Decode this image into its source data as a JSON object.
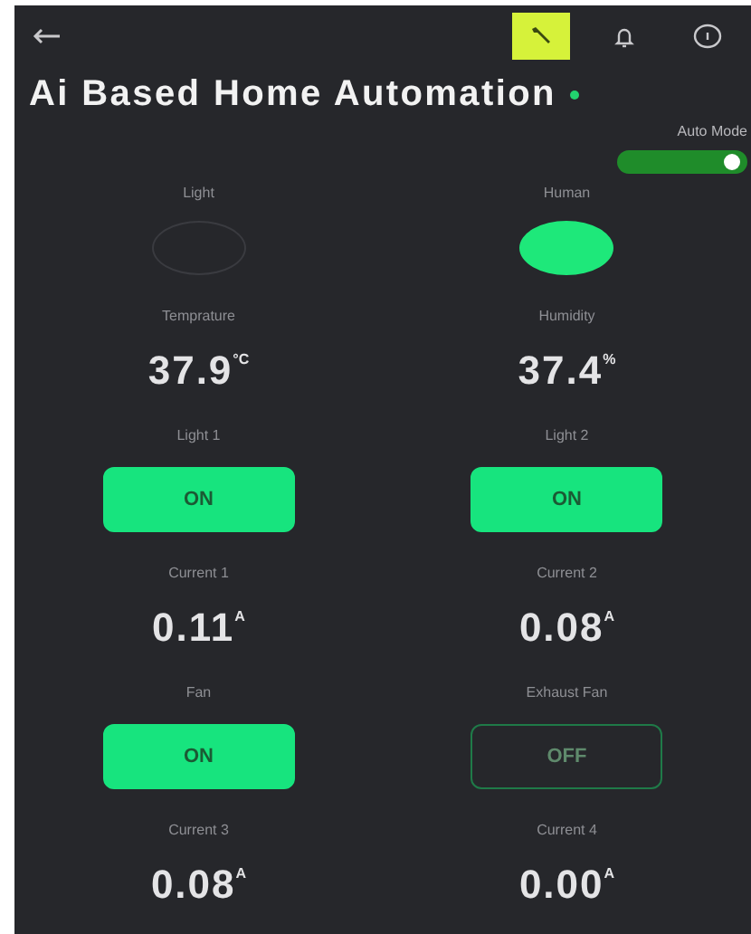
{
  "header": {
    "tools": [
      {
        "kind": "wrench",
        "selected": true
      },
      {
        "kind": "bell",
        "selected": false
      },
      {
        "kind": "info",
        "selected": false
      }
    ]
  },
  "title": "Ai Based Home Automation",
  "online": true,
  "auto_mode": {
    "label": "Auto Mode",
    "on": true
  },
  "widgets": [
    {
      "kind": "led",
      "label": "Light",
      "on": false
    },
    {
      "kind": "led",
      "label": "Human",
      "on": true
    },
    {
      "kind": "value",
      "label": "Temprature",
      "value": "37.9",
      "unit": "°C"
    },
    {
      "kind": "value",
      "label": "Humidity",
      "value": "37.4",
      "unit": "%"
    },
    {
      "kind": "button",
      "label": "Light 1",
      "text": "ON",
      "on": true
    },
    {
      "kind": "button",
      "label": "Light 2",
      "text": "ON",
      "on": true
    },
    {
      "kind": "value",
      "label": "Current 1",
      "value": "0.11",
      "unit": "A"
    },
    {
      "kind": "value",
      "label": "Current 2",
      "value": "0.08",
      "unit": "A"
    },
    {
      "kind": "button",
      "label": "Fan",
      "text": "ON",
      "on": true
    },
    {
      "kind": "button",
      "label": "Exhaust Fan",
      "text": "OFF",
      "on": false
    },
    {
      "kind": "value",
      "label": "Current 3",
      "value": "0.08",
      "unit": "A"
    },
    {
      "kind": "value",
      "label": "Current 4",
      "value": "0.00",
      "unit": "A"
    }
  ]
}
